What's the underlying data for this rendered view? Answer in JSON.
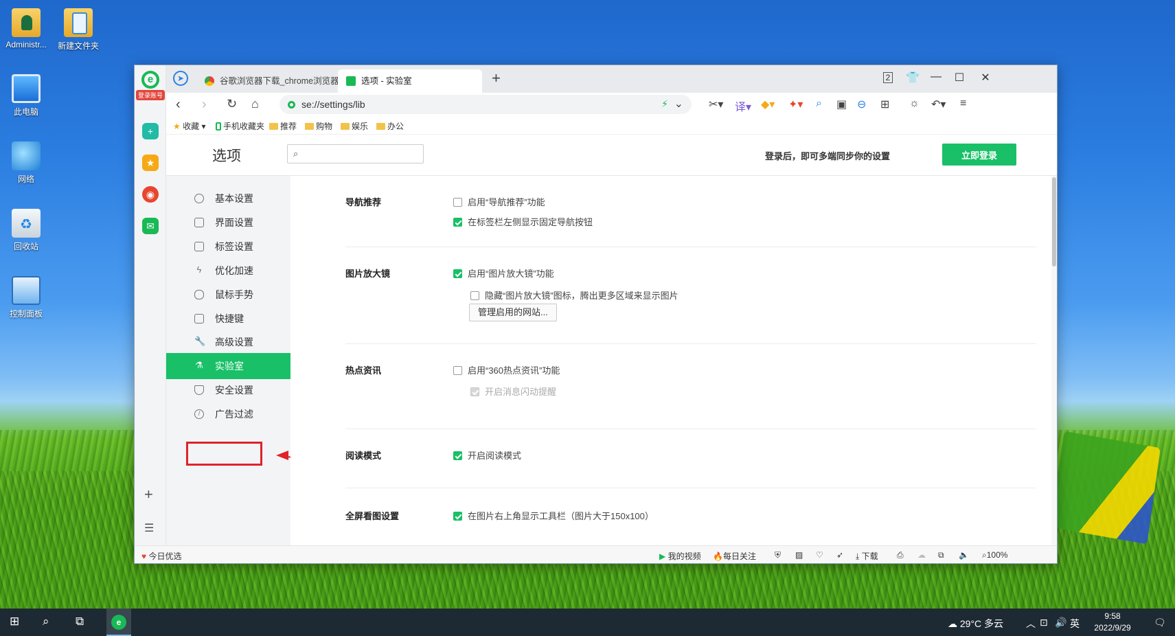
{
  "desktop": {
    "icons": [
      {
        "label": "Administr..."
      },
      {
        "label": "新建文件夹"
      },
      {
        "label": "此电脑"
      },
      {
        "label": "网络"
      },
      {
        "label": "回收站"
      },
      {
        "label": "控制面板"
      }
    ]
  },
  "browser": {
    "rail": {
      "login_label": "登录账号"
    },
    "tabs": [
      {
        "title": "谷歌浏览器下载_chrome浏览器官"
      },
      {
        "title": "选项 - 实验室"
      }
    ],
    "address": {
      "url": "se://settings/lib"
    },
    "bookmarks": [
      "收藏",
      "手机收藏夹",
      "推荐",
      "购物",
      "娱乐",
      "办公"
    ],
    "tab_count": "2"
  },
  "settings": {
    "title": "选项",
    "search_placeholder": "",
    "sync_text": "登录后，即可多端同步你的设置",
    "login_button": "立即登录",
    "menu": [
      {
        "label": "基本设置",
        "icon": "gear-icon"
      },
      {
        "label": "界面设置",
        "icon": "window-icon"
      },
      {
        "label": "标签设置",
        "icon": "tab-icon"
      },
      {
        "label": "优化加速",
        "icon": "lightning-icon"
      },
      {
        "label": "鼠标手势",
        "icon": "mouse-icon"
      },
      {
        "label": "快捷键",
        "icon": "keyboard-icon"
      },
      {
        "label": "高级设置",
        "icon": "wrench-icon"
      },
      {
        "label": "实验室",
        "icon": "flask-icon",
        "active": true
      },
      {
        "label": "安全设置",
        "icon": "shield-icon"
      },
      {
        "label": "广告过滤",
        "icon": "block-icon"
      }
    ],
    "sections": {
      "nav": {
        "title": "导航推荐",
        "opt1": "启用“导航推荐”功能",
        "opt2": "在标签栏左侧显示固定导航按钮"
      },
      "zoom": {
        "title": "图片放大镜",
        "opt1": "启用“图片放大镜”功能",
        "opt2": "隐藏“图片放大镜”图标，腾出更多区域来显示图片",
        "button": "管理启用的网站..."
      },
      "hot": {
        "title": "热点资讯",
        "opt1": "启用“360热点资讯”功能",
        "opt2": "开启消息闪动提醒"
      },
      "read": {
        "title": "阅读模式",
        "opt1": "开启阅读模式"
      },
      "fullscreen": {
        "title": "全屏看图设置",
        "opt1": "在图片右上角显示工具栏（图片大于150x100）"
      }
    }
  },
  "statusbar": {
    "today": "今日优选",
    "video": "我的视频",
    "daily": "每日关注",
    "download": "下载",
    "zoom": "100%"
  },
  "taskbar": {
    "weather": "29°C 多云",
    "ime": "英",
    "time": "9:58",
    "date": "2022/9/29"
  }
}
